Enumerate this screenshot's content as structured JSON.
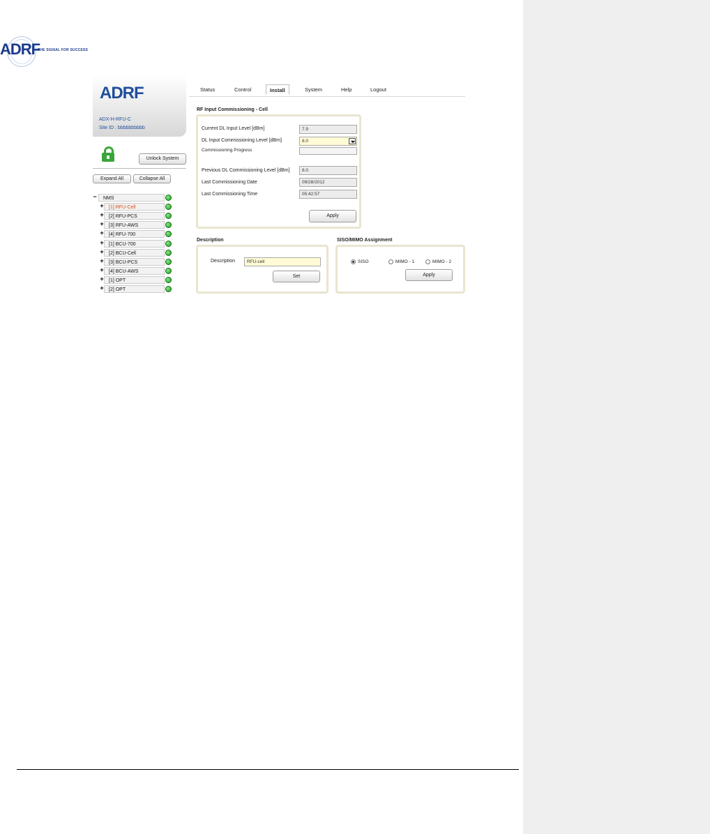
{
  "doc": {
    "logo_text": "ADRF",
    "tagline": "THE SIGNAL FOR SUCCESS"
  },
  "sidebar": {
    "logo": "ADRF",
    "model": "ADX-H-RFU-C",
    "site_id": "Site ID : bbbbbbbbbb",
    "unlock_label": "Unlock System",
    "expand_label": "Expand All",
    "collapse_label": "Collapse All",
    "tree": [
      {
        "toggle": "−",
        "label": "NMS",
        "status": "green"
      },
      {
        "toggle": "+",
        "label": "[1] RFU-Cell",
        "status": "green",
        "active": true
      },
      {
        "toggle": "+",
        "label": "[2] RFU-PCS",
        "status": "green"
      },
      {
        "toggle": "+",
        "label": "[3] RFU-AWS",
        "status": "green"
      },
      {
        "toggle": "+",
        "label": "[4] RFU-700",
        "status": "green"
      },
      {
        "toggle": "+",
        "label": "[1] BCU-700",
        "status": "green"
      },
      {
        "toggle": "+",
        "label": "[2] BCU-Cell",
        "status": "green"
      },
      {
        "toggle": "+",
        "label": "[3] BCU-PCS",
        "status": "green"
      },
      {
        "toggle": "+",
        "label": "[4] BCU-AWS",
        "status": "green"
      },
      {
        "toggle": "+",
        "label": "[1] OPT",
        "status": "green"
      },
      {
        "toggle": "+",
        "label": "[2] OPT",
        "status": "green"
      }
    ]
  },
  "tabs": [
    "Status",
    "Control",
    "Install",
    "System",
    "Help",
    "Logout"
  ],
  "selected_tab": "Install",
  "commissioning": {
    "title": "RF Input Commissioning - Cell",
    "current_dl_label": "Current DL Input Level [dBm]",
    "current_dl_value": "7.9",
    "dl_comm_label": "DL Input Commissioning Level [dBm]",
    "dl_comm_value": "8.0",
    "progress_label": "Commissioning Progress",
    "progress_value": 0,
    "prev_dl_label": "Previous DL Commissioning Level [dBm]",
    "prev_dl_value": "8.0",
    "last_date_label": "Last Commissioning Date",
    "last_date_value": "09/28/2012",
    "last_time_label": "Last Commissioning Time",
    "last_time_value": "05:42:57",
    "apply_label": "Apply"
  },
  "description": {
    "title": "Description",
    "label": "Description",
    "value": "RFU-cell",
    "set_label": "Set"
  },
  "siso_mimo": {
    "title": "SISO/MIMO Assignment",
    "options": [
      "SISO",
      "MIMO - 1",
      "MIMO - 2"
    ],
    "selected": "SISO",
    "apply_label": "Apply"
  },
  "colors": {
    "brand": "#1f4e9c",
    "status_ok": "#1f9a1f",
    "active_item": "#d24a1a",
    "panel_border": "#e9e5cf"
  }
}
